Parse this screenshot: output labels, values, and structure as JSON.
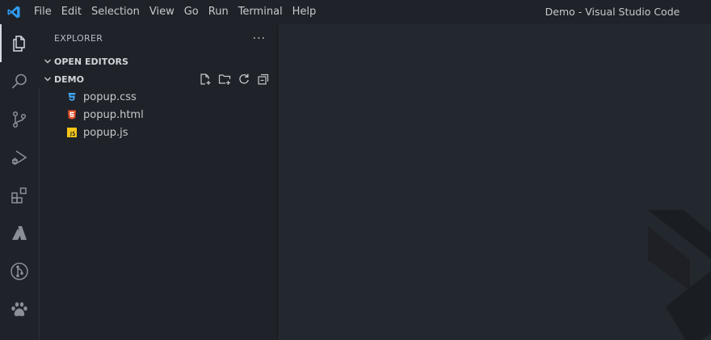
{
  "titlebar": {
    "menu": [
      "File",
      "Edit",
      "Selection",
      "View",
      "Go",
      "Run",
      "Terminal",
      "Help"
    ],
    "window_title": "Demo - Visual Studio Code"
  },
  "activitybar": {
    "items": [
      "explorer-icon",
      "search-icon",
      "source-control-icon",
      "run-debug-icon",
      "extensions-icon",
      "azure-icon",
      "git-graph-icon",
      "paw-icon"
    ]
  },
  "sidebar": {
    "title": "EXPLORER",
    "more": "···",
    "open_editors": "OPEN EDITORS",
    "folder": "DEMO",
    "files": [
      {
        "name": "popup.css",
        "icon": "css-icon"
      },
      {
        "name": "popup.html",
        "icon": "html-icon"
      },
      {
        "name": "popup.js",
        "icon": "js-icon"
      }
    ]
  },
  "colors": {
    "background": "#23272e",
    "sidebar": "#1f2329",
    "accent": "#2f9cf2"
  }
}
